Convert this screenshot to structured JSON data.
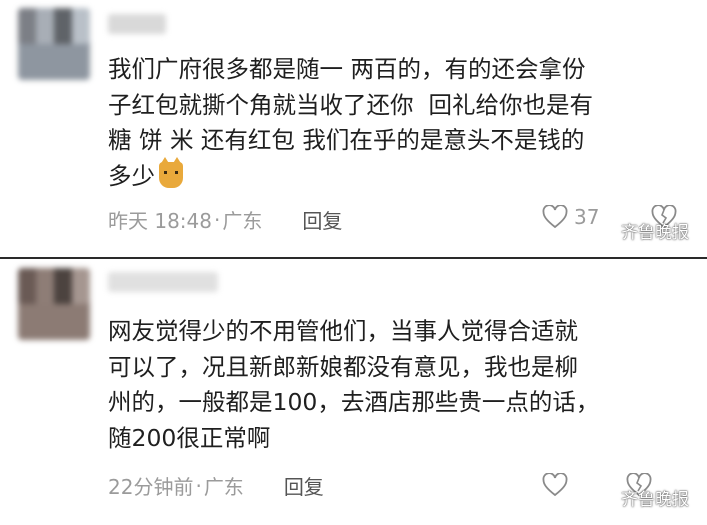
{
  "comments": [
    {
      "text": "我们广府很多都是随一 两百的，有的还会拿份\n子红包就撕个角就当收了还你  回礼给你也是有\n糖 饼 米 还有红包 我们在乎的是意头不是钱的\n多少",
      "emoji": "cat-emoji",
      "time": "昨天 18:48",
      "location": "广东",
      "reply_label": "回复",
      "like_count": "37"
    },
    {
      "text": "网友觉得少的不用管他们，当事人觉得合适就\n可以了，况且新郎新娘都没有意见，我也是柳\n州的，一般都是100，去酒店那些贵一点的话，\n随200很正常啊",
      "time": "22分钟前",
      "location": "广东",
      "reply_label": "回复",
      "like_count": ""
    }
  ],
  "meta_separator": "·",
  "watermark": "齐鲁晚报",
  "colors": {
    "meta_gray": "#9b9b9b",
    "text": "#1f1f1f",
    "divider": "#2a2a2a"
  }
}
